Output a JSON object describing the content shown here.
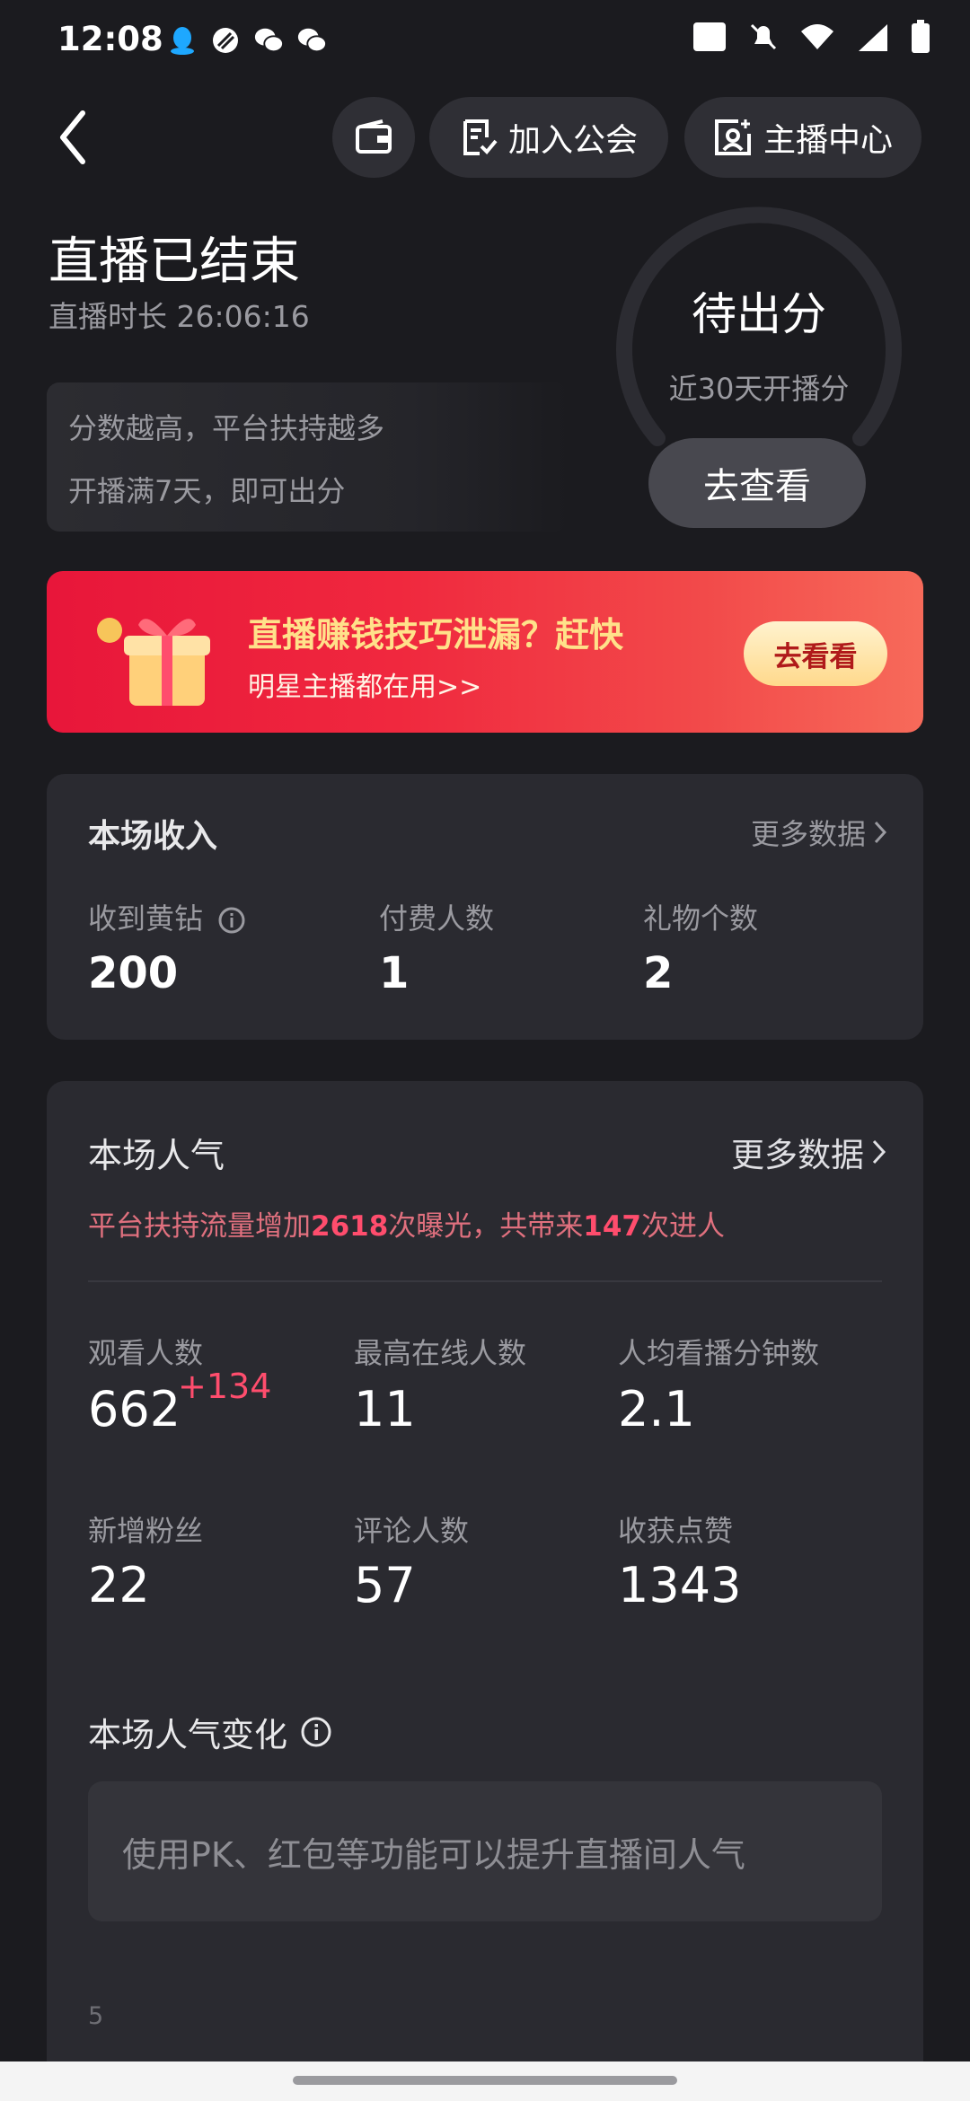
{
  "status_bar": {
    "time": "12:08",
    "left_icons": [
      "qq-icon",
      "circle-slash-icon",
      "wechat-icon",
      "wechat-icon"
    ],
    "right_icons": [
      "volte-icon",
      "bell-off-icon",
      "wifi-icon",
      "signal-4g-icon",
      "battery-icon"
    ],
    "network_label": "4G",
    "volte_label": "VoLTE"
  },
  "nav": {
    "join_guild": "加入公会",
    "host_center": "主播中心"
  },
  "summary": {
    "title": "直播已结束",
    "duration": "直播时长 26:06:16",
    "tip_line1": "分数越高，平台扶持越多",
    "tip_line2": "开播满7天，即可出分"
  },
  "score": {
    "status": "待出分",
    "subtitle": "近30天开播分",
    "button": "去查看"
  },
  "banner": {
    "title": "直播赚钱技巧泄漏？赶快",
    "subtitle": "明星主播都在用>>",
    "button": "去看看"
  },
  "income": {
    "title": "本场收入",
    "more": "更多数据",
    "stats": [
      {
        "label": "收到黄钻",
        "value": "200"
      },
      {
        "label": "付费人数",
        "value": "1"
      },
      {
        "label": "礼物个数",
        "value": "2"
      }
    ]
  },
  "popularity": {
    "title": "本场人气",
    "more": "更多数据",
    "support_prefix": "平台扶持流量增加",
    "support_exposures": "2618",
    "support_mid": "次曝光，共带来",
    "support_entries": "147",
    "support_suffix": "次进人",
    "stats": [
      {
        "label": "观看人数",
        "value": "662",
        "delta": "+134"
      },
      {
        "label": "最高在线人数",
        "value": "11"
      },
      {
        "label": "人均看播分钟数",
        "value": "2.1"
      },
      {
        "label": "新增粉丝",
        "value": "22"
      },
      {
        "label": "评论人数",
        "value": "57"
      },
      {
        "label": "收获点赞",
        "value": "1343"
      }
    ],
    "chart_title": "本场人气变化",
    "hint": "使用PK、红包等功能可以提升直播间人气",
    "axis_tick": "5"
  }
}
